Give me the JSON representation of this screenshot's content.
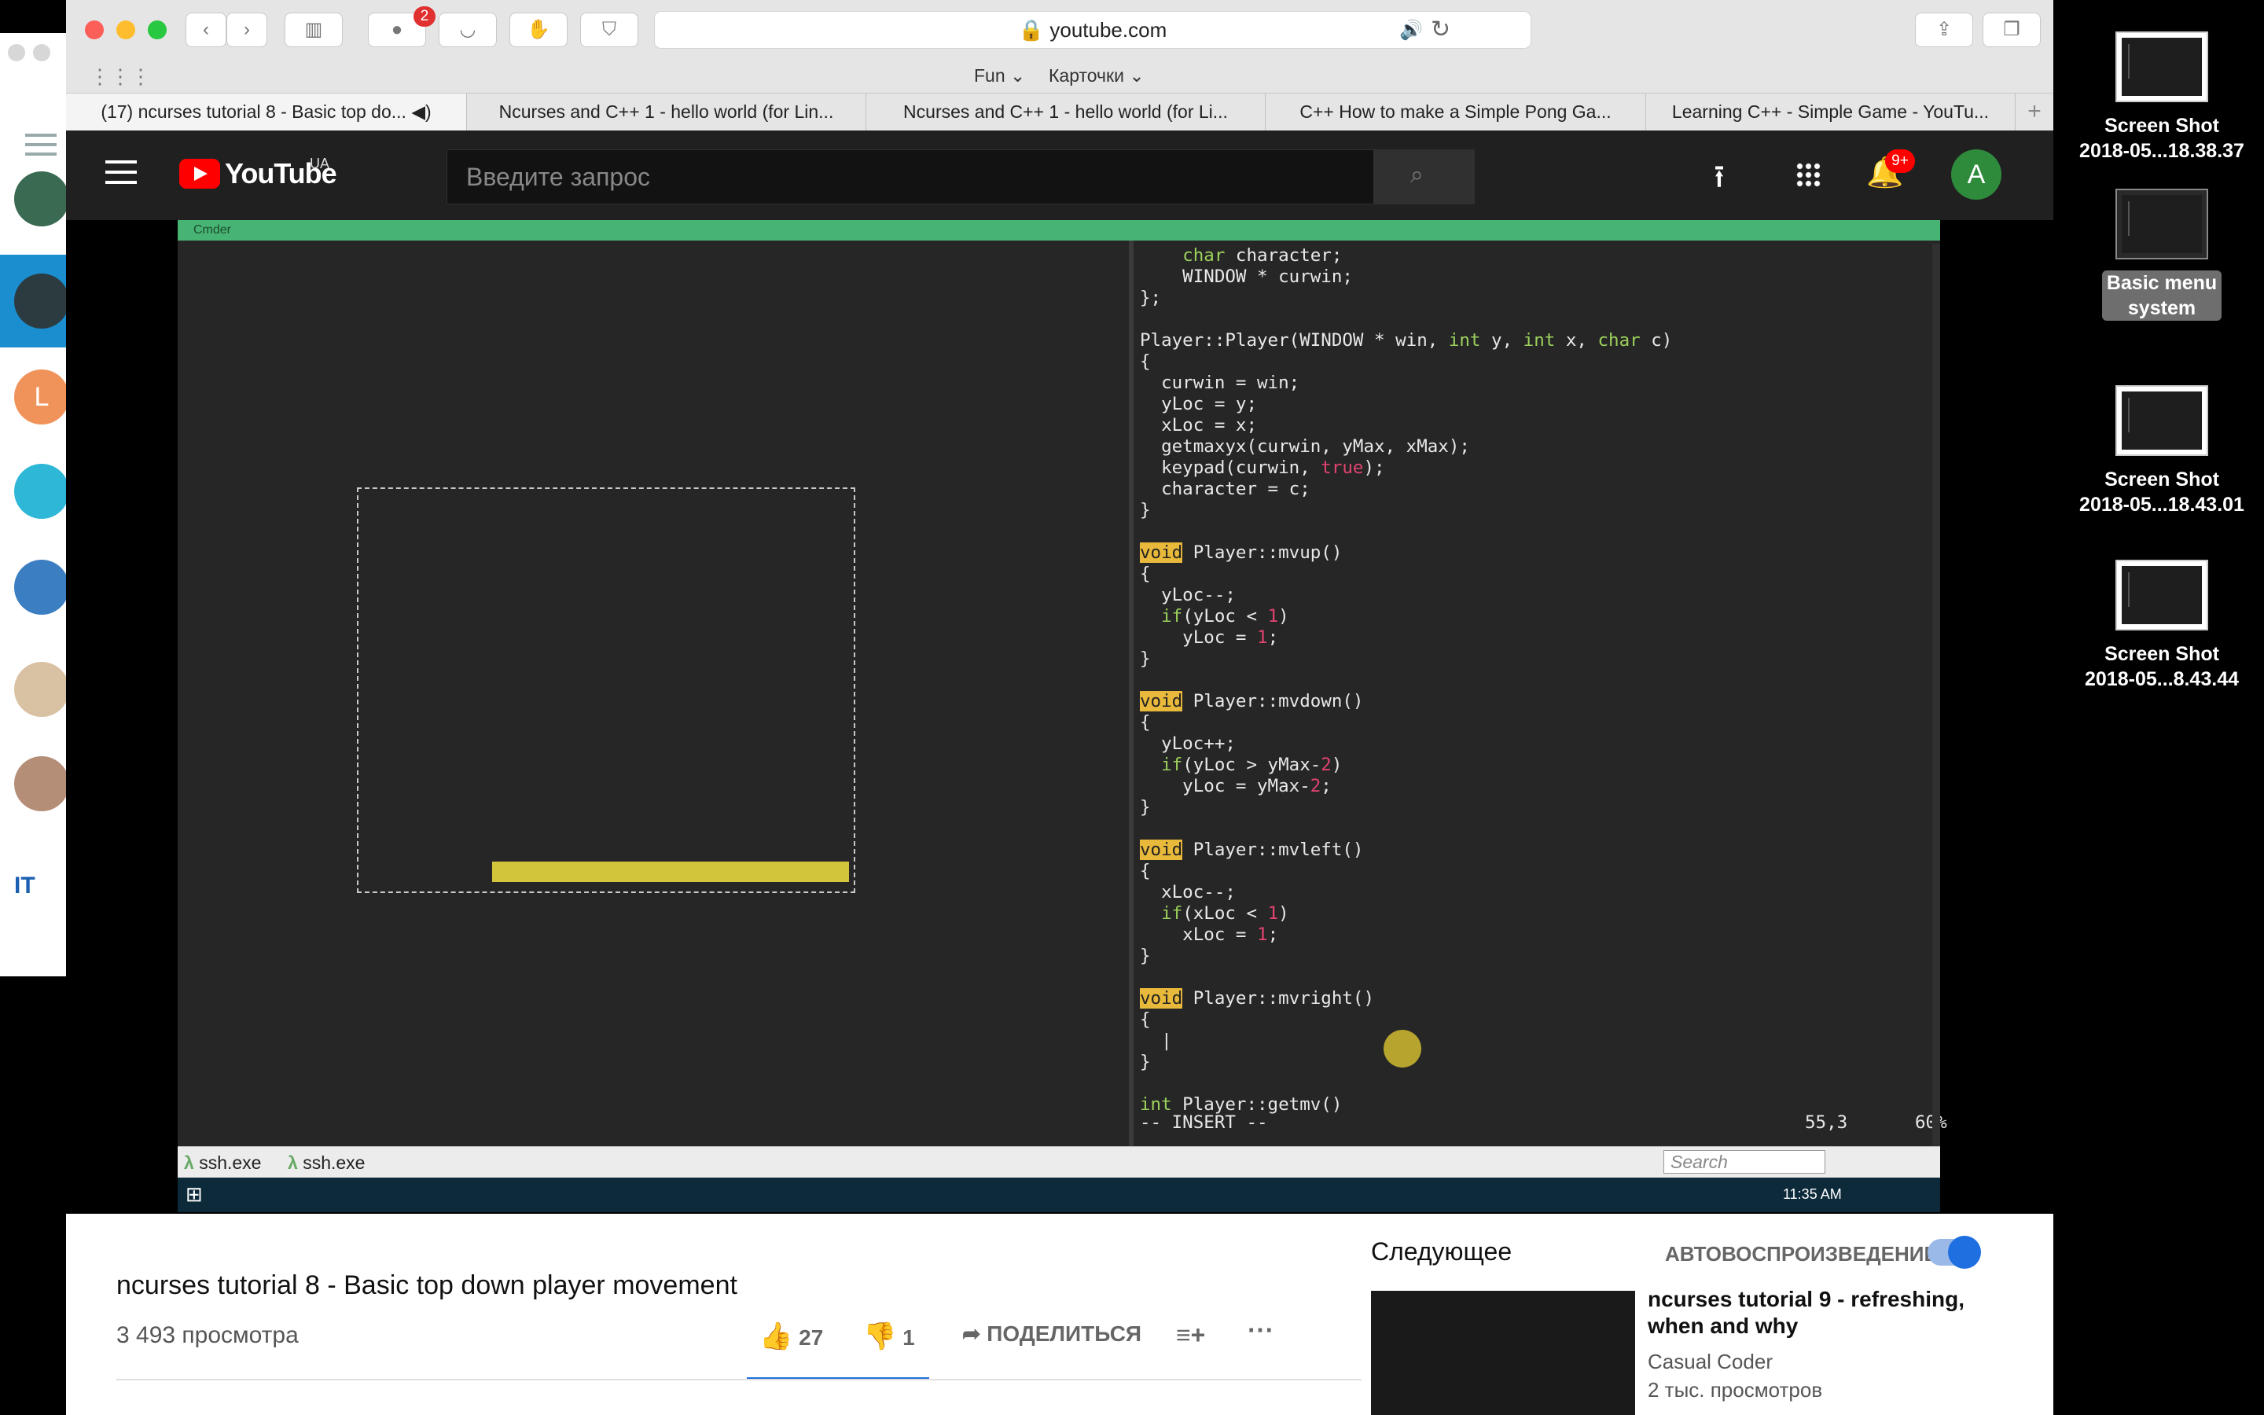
{
  "browser": {
    "url": "youtube.com",
    "abp_badge": "2",
    "favorites": [
      "Fun",
      "Карточки"
    ],
    "tabs": [
      "(17) ncurses tutorial 8 - Basic top do...",
      "Ncurses and C++ 1 - hello world (for Lin...",
      "Ncurses and C++ 1 - hello world (for Li...",
      "C++ How to make a Simple Pong Ga...",
      "Learning C++ - Simple Game - YouTu..."
    ],
    "new_tab": "+"
  },
  "youtube": {
    "logo": "YouTube",
    "region": "UA",
    "search_placeholder": "Введите запрос",
    "notif_badge": "9+",
    "avatar_letter": "A"
  },
  "cmder": {
    "title": "Cmder",
    "code_lines": [
      "    char character;",
      "    WINDOW * curwin;",
      "};",
      "",
      "Player::Player(WINDOW * win, int y, int x, char c)",
      "{",
      "  curwin = win;",
      "  yLoc = y;",
      "  xLoc = x;",
      "  getmaxyx(curwin, yMax, xMax);",
      "  keypad(curwin, true);",
      "  character = c;",
      "}",
      "",
      "void Player::mvup()",
      "{",
      "  yLoc--;",
      "  if(yLoc < 1)",
      "    yLoc = 1;",
      "}",
      "",
      "void Player::mvdown()",
      "{",
      "  yLoc++;",
      "  if(yLoc > yMax-2)",
      "    yLoc = yMax-2;",
      "}",
      "",
      "void Player::mvleft()",
      "{",
      "  xLoc--;",
      "  if(xLoc < 1)",
      "    xLoc = 1;",
      "}",
      "",
      "void Player::mvright()",
      "{",
      "  |",
      "}",
      "",
      "int Player::getmv()"
    ],
    "mode": "-- INSERT --",
    "position": "55,3",
    "percent": "60%",
    "console_tabs": [
      "ssh.exe",
      "ssh.exe"
    ],
    "search_placeholder": "Search",
    "taskbar_time": "11:35 AM"
  },
  "video": {
    "title": "ncurses tutorial 8 - Basic top down player movement",
    "views": "3 493 просмотра",
    "likes": "27",
    "dislikes": "1",
    "share": "ПОДЕЛИТЬСЯ"
  },
  "sidebar": {
    "next_label": "Следующее",
    "autoplay_label": "АВТОВОСПРОИЗВЕДЕНИЕ",
    "next_title": "ncurses tutorial 9 - refreshing, when and why",
    "next_channel": "Casual Coder",
    "next_views": "2 тыс. просмотров"
  },
  "desktop_icons": [
    {
      "line1": "Screen Shot",
      "line2": "2018-05...18.38.37"
    },
    {
      "line1": "Basic menu",
      "line2": "system"
    },
    {
      "line1": "Screen Shot",
      "line2": "2018-05...18.43.01"
    },
    {
      "line1": "Screen Shot",
      "line2": "2018-05...8.43.44"
    }
  ],
  "colors": {
    "accent_red": "#ff0000",
    "cmder_green": "#47b473",
    "paddle": "#d2c53c",
    "keyword_green": "#9bd15b",
    "literal_pink": "#e0436f"
  }
}
